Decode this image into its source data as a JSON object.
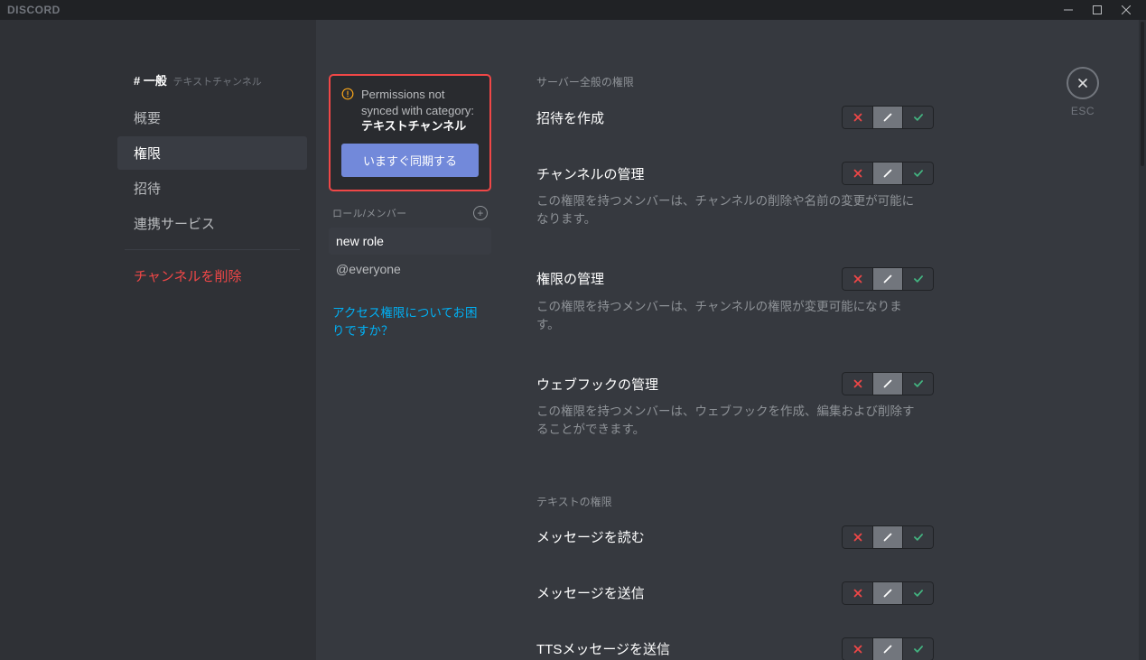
{
  "titlebar": {
    "brand": "DISCORD"
  },
  "close": {
    "esc": "ESC"
  },
  "channelHeader": {
    "hash": "# 一般",
    "sub": "テキストチャンネル"
  },
  "nav": {
    "overview": "概要",
    "permissions": "権限",
    "invites": "招待",
    "integrations": "連携サービス",
    "delete": "チャンネルを削除"
  },
  "syncBox": {
    "text1": "Permissions not synced with category: ",
    "bold": "テキストチャンネル",
    "button": "いますぐ同期する"
  },
  "rolesHeader": "ロール/メンバー",
  "roles": {
    "newrole": "new role",
    "everyone": "@everyone"
  },
  "helpLink": "アクセス権限についてお困りですか？",
  "sections": {
    "server": "サーバー全般の権限",
    "text": "テキストの権限"
  },
  "perms": {
    "createInvite": {
      "label": "招待を作成"
    },
    "manageChannel": {
      "label": "チャンネルの管理",
      "desc": "この権限を持つメンバーは、チャンネルの削除や名前の変更が可能になります。"
    },
    "managePerms": {
      "label": "権限の管理",
      "desc": "この権限を持つメンバーは、チャンネルの権限が変更可能になります。"
    },
    "manageWebhooks": {
      "label": "ウェブフックの管理",
      "desc": "この権限を持つメンバーは、ウェブフックを作成、編集および削除することができます。"
    },
    "readMessages": {
      "label": "メッセージを読む"
    },
    "sendMessages": {
      "label": "メッセージを送信"
    },
    "ttsMessages": {
      "label": "TTSメッセージを送信"
    }
  }
}
